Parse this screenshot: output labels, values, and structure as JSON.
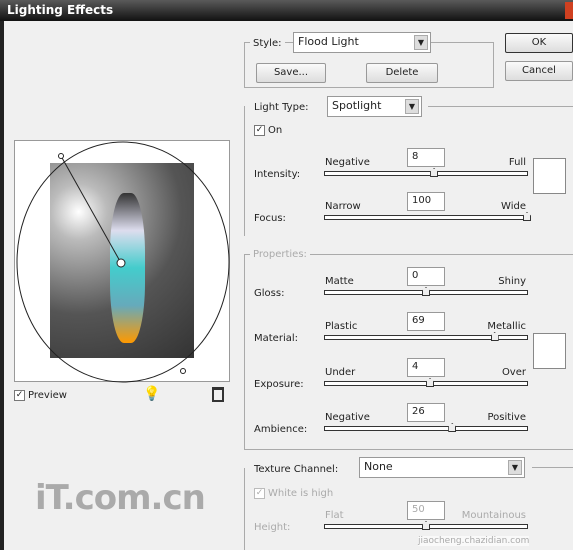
{
  "window": {
    "title": "Lighting Effects"
  },
  "buttons": {
    "ok": "OK",
    "cancel": "Cancel",
    "save": "Save...",
    "delete": "Delete"
  },
  "style": {
    "label": "Style:",
    "value": "Flood Light"
  },
  "light_type": {
    "label": "Light Type:",
    "value": "Spotlight",
    "on_label": "On",
    "on_checked": true
  },
  "intensity": {
    "label": "Intensity:",
    "min_label": "Negative",
    "max_label": "Full",
    "value": "8",
    "percent": 54
  },
  "focus": {
    "label": "Focus:",
    "min_label": "Narrow",
    "max_label": "Wide",
    "value": "100",
    "percent": 100
  },
  "properties": {
    "label": "Properties:"
  },
  "gloss": {
    "label": "Gloss:",
    "min_label": "Matte",
    "max_label": "Shiny",
    "value": "0",
    "percent": 50
  },
  "material": {
    "label": "Material:",
    "min_label": "Plastic",
    "max_label": "Metallic",
    "value": "69",
    "percent": 84
  },
  "exposure": {
    "label": "Exposure:",
    "min_label": "Under",
    "max_label": "Over",
    "value": "4",
    "percent": 52
  },
  "ambience": {
    "label": "Ambience:",
    "min_label": "Negative",
    "max_label": "Positive",
    "value": "26",
    "percent": 63
  },
  "texture": {
    "label": "Texture Channel:",
    "value": "None",
    "white_high_label": "White is high"
  },
  "height": {
    "label": "Height:",
    "min_label": "Flat",
    "max_label": "Mountainous",
    "value": "50",
    "percent": 50
  },
  "preview": {
    "label": "Preview",
    "checked": true
  },
  "colors": {
    "light_color": "#ffffff",
    "material_color": "#ffffff"
  },
  "watermark": {
    "left": "iT.com.cn",
    "right": "jiaocheng.chazidian.com"
  }
}
